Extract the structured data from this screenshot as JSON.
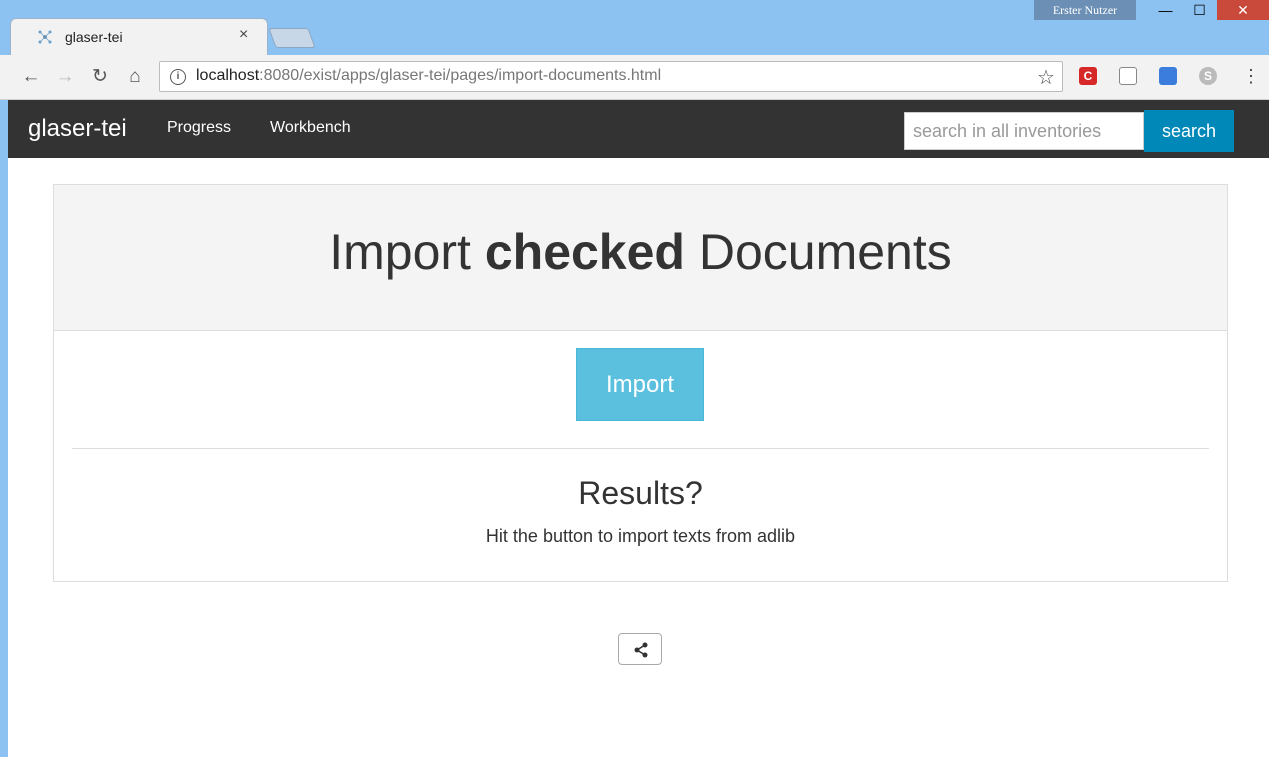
{
  "browser": {
    "tab_title": "glaser-tei",
    "tab_close": "×",
    "user_badge": "Erster Nutzer",
    "url_host": "localhost",
    "url_rest": ":8080/exist/apps/glaser-tei/pages/import-documents.html",
    "window_controls": {
      "minimize": "—",
      "maximize": "☐",
      "close": "✕"
    }
  },
  "navbar": {
    "brand": "glaser-tei",
    "links": [
      "Progress",
      "Workbench"
    ],
    "search_placeholder": "search in all inventories",
    "search_button": "search"
  },
  "main": {
    "title_pre": "Import ",
    "title_bold": "checked",
    "title_post": " Documents",
    "import_button": "Import",
    "results_heading": "Results?",
    "results_text": "Hit the button to import texts from adlib"
  },
  "colors": {
    "navbar_bg": "#333333",
    "search_button_bg": "#0088b8",
    "import_button_bg": "#5bc0de"
  }
}
